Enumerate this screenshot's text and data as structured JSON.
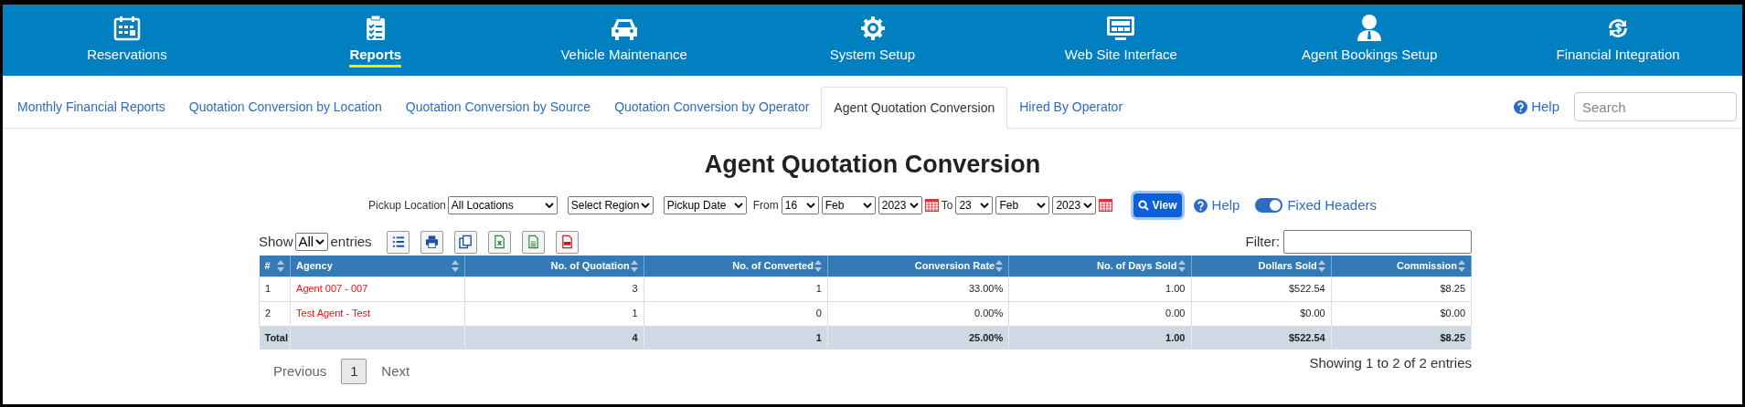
{
  "nav": [
    {
      "label": "Reservations",
      "selected": false
    },
    {
      "label": "Reports",
      "selected": true
    },
    {
      "label": "Vehicle Maintenance",
      "selected": false
    },
    {
      "label": "System Setup",
      "selected": false
    },
    {
      "label": "Web Site Interface",
      "selected": false
    },
    {
      "label": "Agent Bookings Setup",
      "selected": false
    },
    {
      "label": "Financial Integration",
      "selected": false
    }
  ],
  "tabs": [
    {
      "label": "Monthly Financial Reports",
      "selected": false
    },
    {
      "label": "Quotation Conversion by Location",
      "selected": false
    },
    {
      "label": "Quotation Conversion by Source",
      "selected": false
    },
    {
      "label": "Quotation Conversion by Operator",
      "selected": false
    },
    {
      "label": "Agent Quotation Conversion",
      "selected": true
    },
    {
      "label": "Hired By Operator",
      "selected": false
    }
  ],
  "help_link": "Help",
  "search": {
    "placeholder": "Search"
  },
  "title": "Agent Quotation Conversion",
  "filters": {
    "pickup_location_label": "Pickup Location",
    "pickup_location": "All Locations",
    "region": "Select Region",
    "date_type": "Pickup Date",
    "from_label": "From",
    "from_day": "16",
    "from_month": "Feb",
    "from_year": "2023",
    "to_label": "To",
    "to_day": "23",
    "to_month": "Feb",
    "to_year": "2023",
    "view_button": "View",
    "help": "Help",
    "fixed_headers": {
      "label": "Fixed Headers",
      "on": true
    }
  },
  "toolbar": {
    "show_label": "Show",
    "entries_value": "All",
    "entries_label": "entries",
    "filter_label": "Filter:"
  },
  "table": {
    "columns": [
      "#",
      "Agency",
      "No. of Quotation",
      "No. of Converted",
      "Conversion Rate",
      "No. of Days Sold",
      "Dollars Sold",
      "Commission"
    ],
    "rows": [
      [
        "1",
        "Agent 007 - 007",
        "3",
        "1",
        "33.00%",
        "1.00",
        "$522.54",
        "$8.25"
      ],
      [
        "2",
        "Test Agent - Test",
        "1",
        "0",
        "0.00%",
        "0.00",
        "$0.00",
        "$0.00"
      ]
    ],
    "total": {
      "label": "Total",
      "values": [
        "4",
        "1",
        "25.00%",
        "1.00",
        "$522.54",
        "$8.25"
      ]
    }
  },
  "pagination": {
    "previous": "Previous",
    "pages": [
      {
        "label": "1",
        "selected": true
      }
    ],
    "next": "Next",
    "info": "Showing 1 to 2 of 2 entries"
  }
}
